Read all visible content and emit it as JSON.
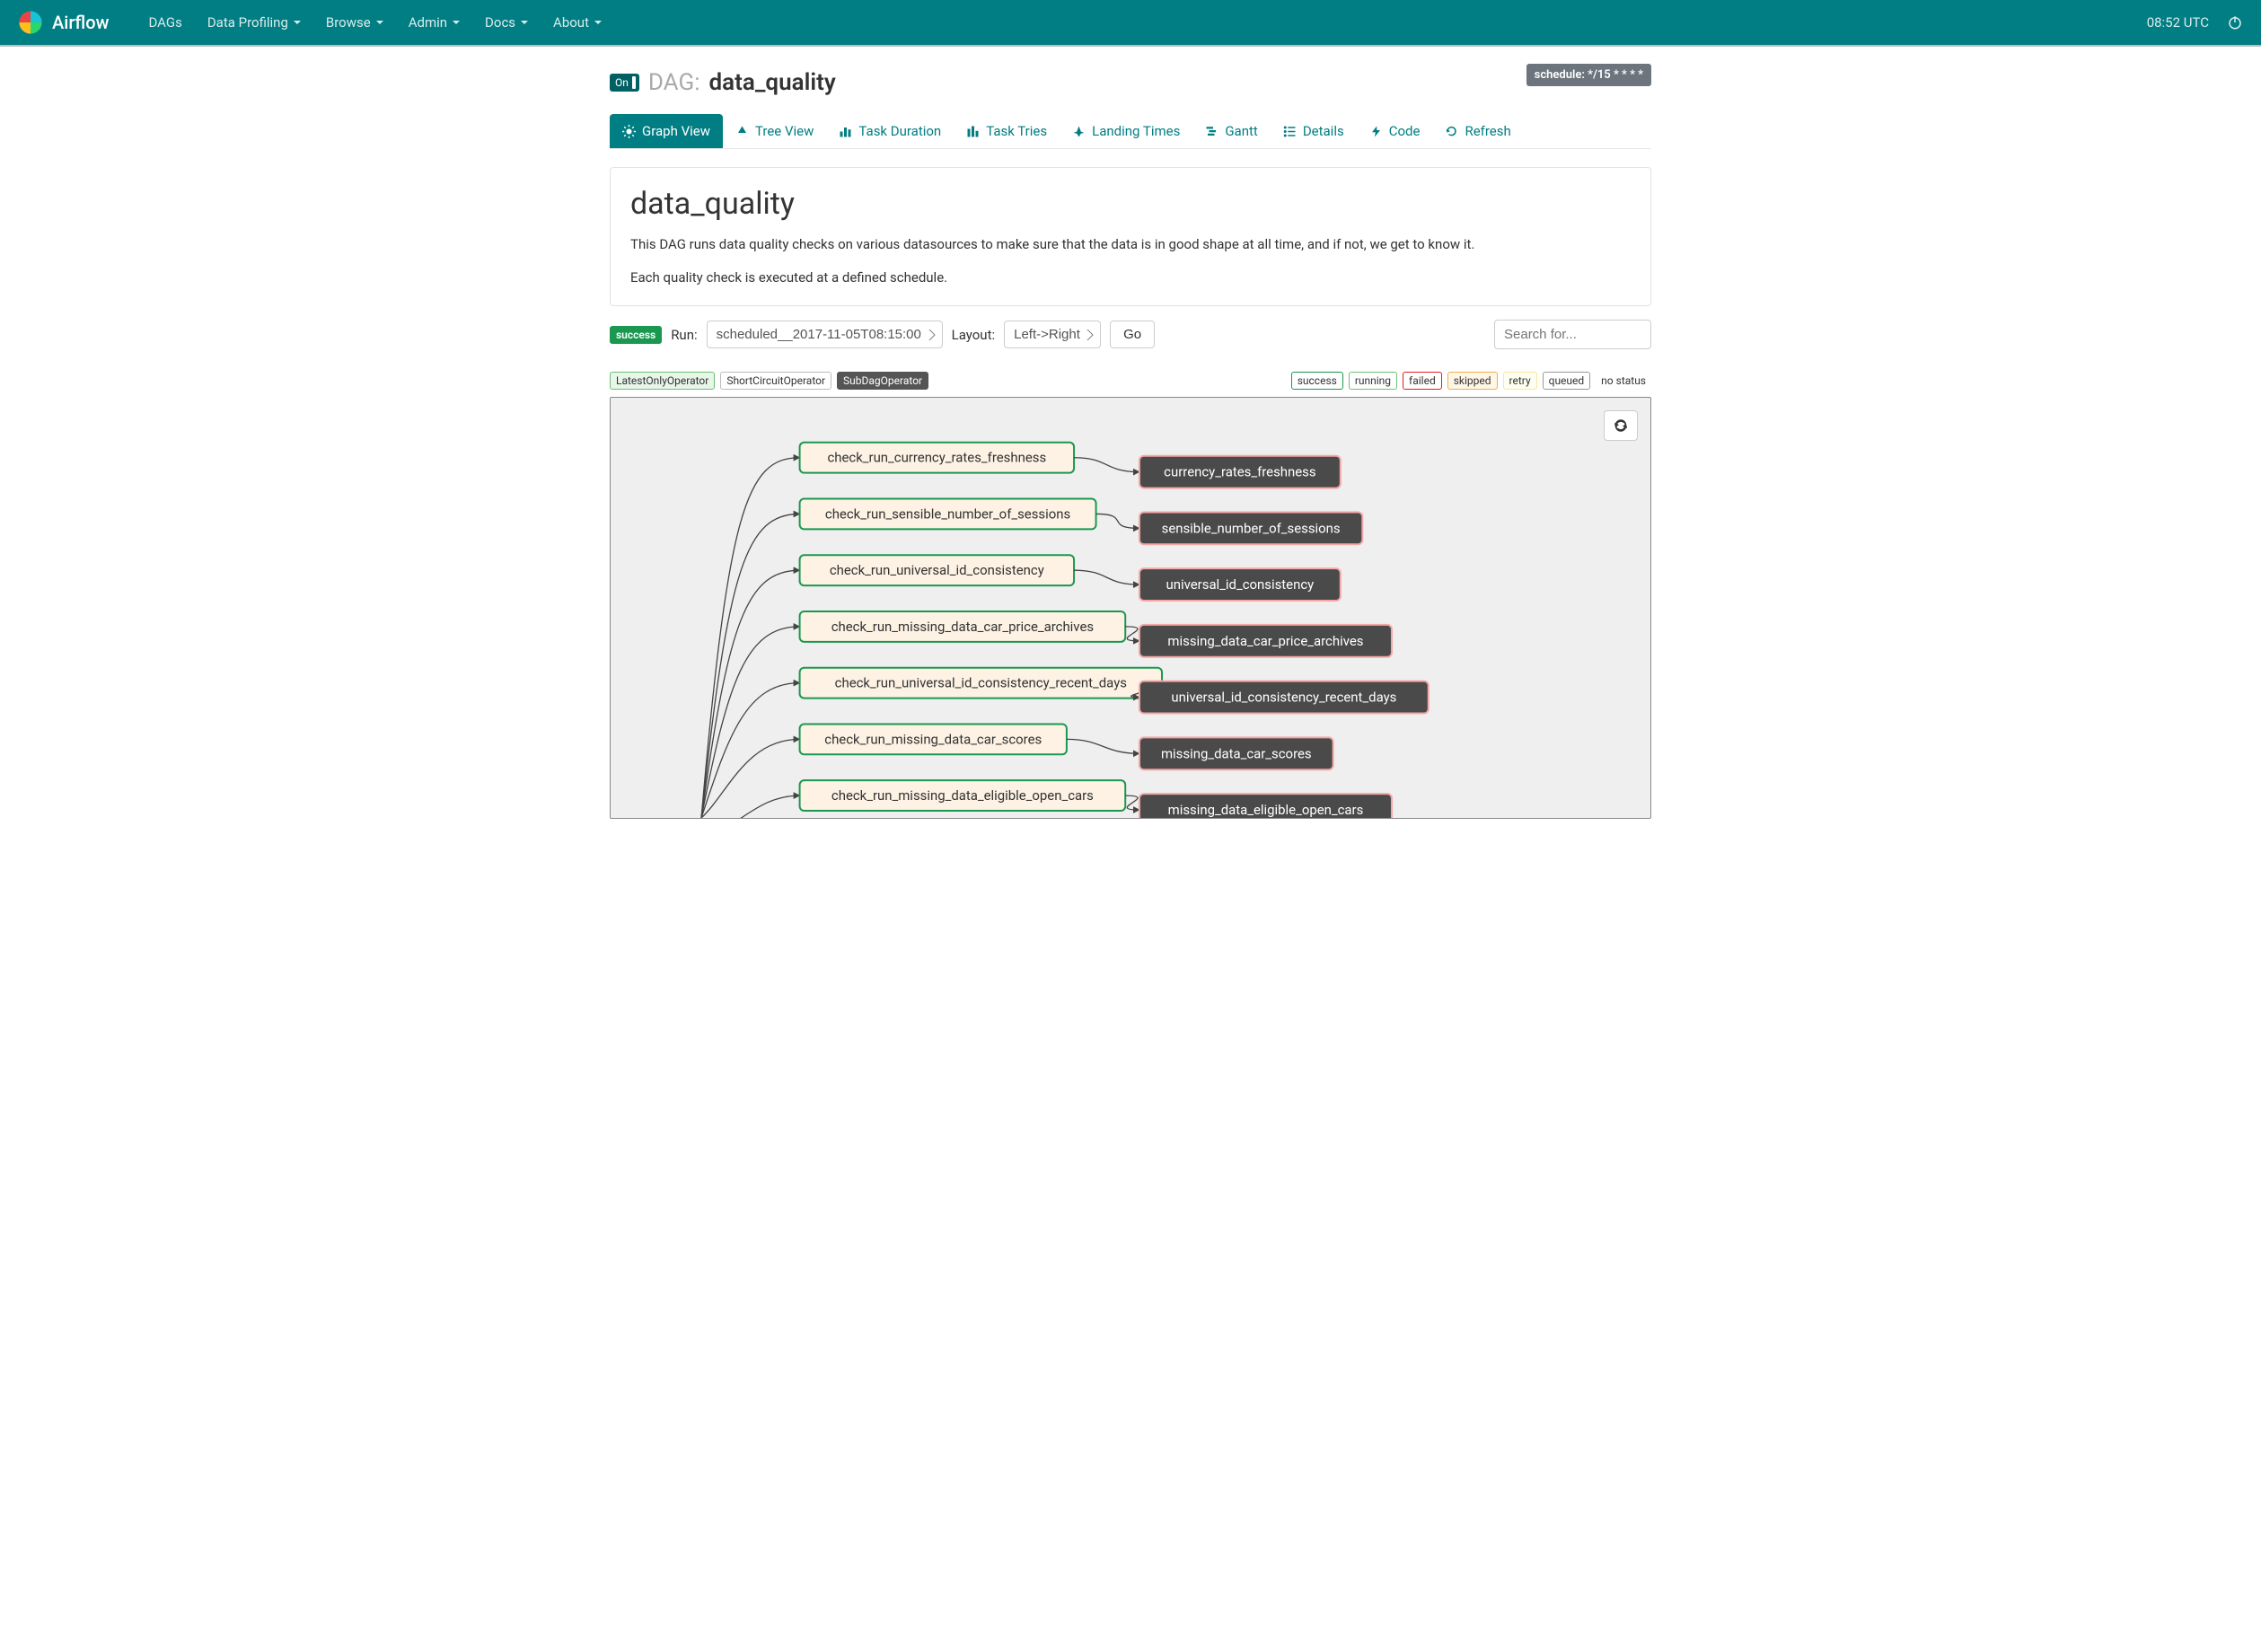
{
  "nav": {
    "brand": "Airflow",
    "items": [
      "DAGs",
      "Data Profiling",
      "Browse",
      "Admin",
      "Docs",
      "About"
    ],
    "dropdown": [
      false,
      true,
      true,
      true,
      true,
      true
    ],
    "clock": "08:52 UTC"
  },
  "dag": {
    "toggle": "On",
    "label": "DAG:",
    "name": "data_quality",
    "schedule": "schedule: */15 * * * *"
  },
  "tabs": {
    "items": [
      "Graph View",
      "Tree View",
      "Task Duration",
      "Task Tries",
      "Landing Times",
      "Gantt",
      "Details",
      "Code",
      "Refresh"
    ],
    "active_index": 0
  },
  "panel": {
    "title": "data_quality",
    "p1": "This DAG runs data quality checks on various datasources to make sure that the data is in good shape at all time, and if not, we get to know it.",
    "p2": "Each quality check is executed at a defined schedule."
  },
  "controls": {
    "state": "success",
    "run_label": "Run:",
    "run_value": "scheduled__2017-11-05T08:15:00",
    "layout_label": "Layout:",
    "layout_value": "Left->Right",
    "go": "Go",
    "search_placeholder": "Search for..."
  },
  "operators": {
    "latest": "LatestOnlyOperator",
    "short": "ShortCircuitOperator",
    "subdag": "SubDagOperator"
  },
  "states": {
    "success": "success",
    "running": "running",
    "failed": "failed",
    "skipped": "skipped",
    "retry": "retry",
    "queued": "queued",
    "none": "no status"
  },
  "graph": {
    "pairs": [
      {
        "check": "check_run_currency_rates_freshness",
        "sub": "currency_rates_freshness"
      },
      {
        "check": "check_run_sensible_number_of_sessions",
        "sub": "sensible_number_of_sessions"
      },
      {
        "check": "check_run_universal_id_consistency",
        "sub": "universal_id_consistency"
      },
      {
        "check": "check_run_missing_data_car_price_archives",
        "sub": "missing_data_car_price_archives"
      },
      {
        "check": "check_run_universal_id_consistency_recent_days",
        "sub": "universal_id_consistency_recent_days"
      },
      {
        "check": "check_run_missing_data_car_scores",
        "sub": "missing_data_car_scores"
      },
      {
        "check": "check_run_missing_data_eligible_open_cars",
        "sub": "missing_data_eligible_open_cars"
      }
    ]
  }
}
